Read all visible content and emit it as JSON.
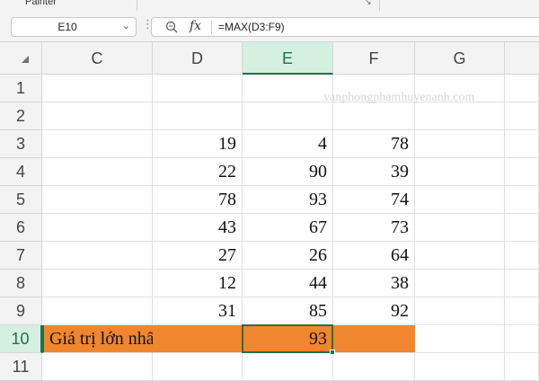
{
  "ribbon": {
    "painter_label": "Painter"
  },
  "formula_bar": {
    "name_box": "E10",
    "function_icon": "fx",
    "formula": "=MAX(D3:F9)"
  },
  "columns": [
    "C",
    "D",
    "E",
    "F",
    "G"
  ],
  "active_column": "E",
  "rows": [
    "1",
    "2",
    "3",
    "4",
    "5",
    "6",
    "7",
    "8",
    "9",
    "10",
    "11"
  ],
  "active_row": "10",
  "watermark": "vanphongphamhuyenanh.com",
  "data": {
    "D": [
      "19",
      "22",
      "78",
      "43",
      "27",
      "12",
      "31"
    ],
    "E": [
      "4",
      "90",
      "93",
      "67",
      "26",
      "44",
      "85"
    ],
    "F": [
      "78",
      "39",
      "74",
      "73",
      "64",
      "38",
      "92"
    ]
  },
  "result_row": {
    "label": "Giá trị lớn nhất",
    "value": "93"
  },
  "colors": {
    "accent": "#217346",
    "highlight": "#f0862e",
    "header_bg": "#f3f3f3"
  }
}
